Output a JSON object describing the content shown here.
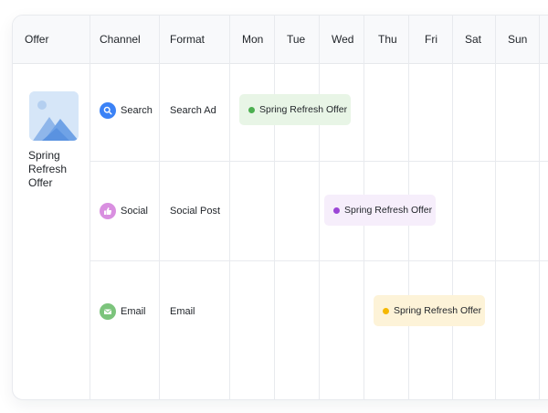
{
  "columns": {
    "offer": "Offer",
    "channel": "Channel",
    "format": "Format",
    "days": [
      "Mon",
      "Tue",
      "Wed",
      "Thu",
      "Fri",
      "Sat",
      "Sun"
    ]
  },
  "offer": {
    "name": "Spring Refresh Offer",
    "thumbnail_icon": "image-placeholder-icon"
  },
  "rows": [
    {
      "channel": "Search",
      "channel_icon": "search-icon",
      "icon_color": "#3b82f6",
      "format": "Search Ad",
      "pill": {
        "label": "Spring Refresh Offer",
        "bg": "#e8f5e6",
        "dot": "#4caf50"
      }
    },
    {
      "channel": "Social",
      "channel_icon": "thumbs-up-icon",
      "icon_color": "#c25bd0",
      "format": "Social Post",
      "pill": {
        "label": "Spring Refresh Offer",
        "bg": "#f6eefb",
        "dot": "#9b46d6"
      }
    },
    {
      "channel": "Email",
      "channel_icon": "mail-icon",
      "icon_color": "#5cb85c",
      "format": "Email",
      "pill": {
        "label": "Spring Refresh Offer",
        "bg": "#fdf3d8",
        "dot": "#f5b800"
      }
    }
  ]
}
